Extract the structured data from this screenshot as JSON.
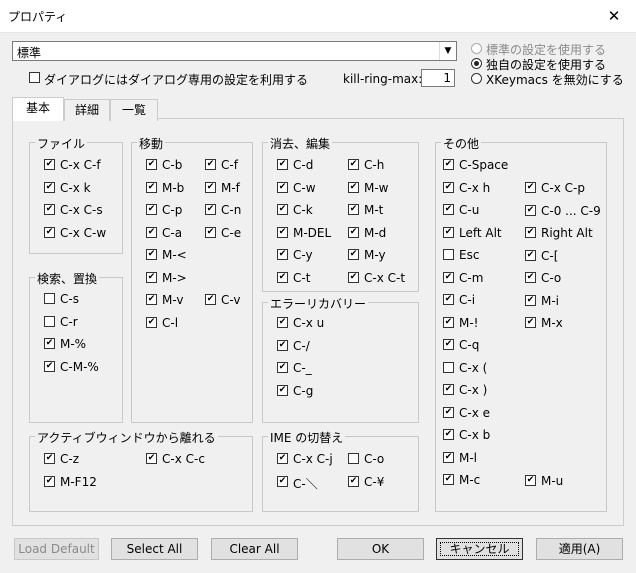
{
  "window": {
    "title": "プロパティ",
    "close_glyph": "✕"
  },
  "combo": {
    "value": "標準",
    "arrow": "▼"
  },
  "top_options": {
    "dialog_setting": {
      "label": "ダイアログにはダイアログ専用の設定を利用する",
      "checked": false
    },
    "kill_ring": {
      "label": "kill-ring-max:",
      "value": "1"
    },
    "radios": [
      {
        "label": "標準の設定を使用する",
        "selected": false,
        "disabled": true
      },
      {
        "label": "独自の設定を使用する",
        "selected": true,
        "disabled": false
      },
      {
        "label": "XKeymacs を無効にする",
        "selected": false,
        "disabled": false
      }
    ]
  },
  "tabs": [
    {
      "label": "基本"
    },
    {
      "label": "詳細"
    },
    {
      "label": "一覧"
    }
  ],
  "groups": {
    "file": {
      "title": "ファイル",
      "items": [
        {
          "label": "C-x C-f",
          "checked": true
        },
        {
          "label": "C-x k",
          "checked": true
        },
        {
          "label": "C-x C-s",
          "checked": true
        },
        {
          "label": "C-x C-w",
          "checked": true
        }
      ]
    },
    "search": {
      "title": "検索、置換",
      "items": [
        {
          "label": "C-s",
          "checked": false
        },
        {
          "label": "C-r",
          "checked": false
        },
        {
          "label": "M-%",
          "checked": true
        },
        {
          "label": "C-M-%",
          "checked": true
        }
      ]
    },
    "move": {
      "title": "移動",
      "col1": [
        {
          "label": "C-b",
          "checked": true
        },
        {
          "label": "M-b",
          "checked": true
        },
        {
          "label": "C-p",
          "checked": true
        },
        {
          "label": "C-a",
          "checked": true
        },
        {
          "label": "M-<",
          "checked": true
        },
        {
          "label": "M->",
          "checked": true
        },
        {
          "label": "M-v",
          "checked": true
        },
        {
          "label": "C-l",
          "checked": true
        }
      ],
      "col2": [
        {
          "label": "C-f",
          "checked": true
        },
        {
          "label": "M-f",
          "checked": true
        },
        {
          "label": "C-n",
          "checked": true
        },
        {
          "label": "C-e",
          "checked": true
        },
        {
          "label": "C-v",
          "checked": true
        }
      ]
    },
    "edit": {
      "title": "消去、編集",
      "col1": [
        {
          "label": "C-d",
          "checked": true
        },
        {
          "label": "C-w",
          "checked": true
        },
        {
          "label": "C-k",
          "checked": true
        },
        {
          "label": "M-DEL",
          "checked": true
        },
        {
          "label": "C-y",
          "checked": true
        },
        {
          "label": "C-t",
          "checked": true
        }
      ],
      "col2": [
        {
          "label": "C-h",
          "checked": true
        },
        {
          "label": "M-w",
          "checked": true
        },
        {
          "label": "M-t",
          "checked": true
        },
        {
          "label": "M-d",
          "checked": true
        },
        {
          "label": "M-y",
          "checked": true
        },
        {
          "label": "C-x C-t",
          "checked": true
        }
      ]
    },
    "recovery": {
      "title": "エラーリカバリー",
      "items": [
        {
          "label": "C-x u",
          "checked": true
        },
        {
          "label": "C-/",
          "checked": true
        },
        {
          "label": "C-_",
          "checked": true
        },
        {
          "label": "C-g",
          "checked": true
        }
      ]
    },
    "other": {
      "title": "その他",
      "col1": [
        {
          "label": "C-Space",
          "checked": true
        },
        {
          "label": "C-x h",
          "checked": true
        },
        {
          "label": "C-u",
          "checked": true
        },
        {
          "label": "Left Alt",
          "checked": true
        },
        {
          "label": "Esc",
          "checked": false
        },
        {
          "label": "C-m",
          "checked": true
        },
        {
          "label": "C-i",
          "checked": true
        },
        {
          "label": "M-!",
          "checked": true
        },
        {
          "label": "C-q",
          "checked": true
        },
        {
          "label": "C-x (",
          "checked": false
        },
        {
          "label": "C-x )",
          "checked": true
        },
        {
          "label": "C-x e",
          "checked": true
        },
        {
          "label": "C-x b",
          "checked": true
        },
        {
          "label": "M-l",
          "checked": true
        },
        {
          "label": "M-c",
          "checked": true
        }
      ],
      "col2": [
        {
          "label": "C-x C-p",
          "checked": true
        },
        {
          "label": "C-0 ... C-9",
          "checked": true
        },
        {
          "label": "Right Alt",
          "checked": true
        },
        {
          "label": "C-[",
          "checked": true
        },
        {
          "label": "C-o",
          "checked": true
        },
        {
          "label": "M-i",
          "checked": true
        },
        {
          "label": "M-x",
          "checked": true
        },
        {
          "label": "M-u",
          "checked": true
        }
      ]
    },
    "active": {
      "title": "アクティブウィンドウから離れる",
      "items": [
        {
          "label": "C-z",
          "checked": true
        },
        {
          "label": "C-x C-c",
          "checked": true
        },
        {
          "label": "M-F12",
          "checked": true
        }
      ]
    },
    "ime": {
      "title": "IME の切替え",
      "items": [
        {
          "label": "C-x C-j",
          "checked": true
        },
        {
          "label": "C-o",
          "checked": false
        },
        {
          "label": "C-＼",
          "checked": true
        },
        {
          "label": "C-¥",
          "checked": true
        }
      ]
    }
  },
  "buttons": {
    "load_default": "Load Default",
    "select_all": "Select All",
    "clear_all": "Clear All",
    "ok": "OK",
    "cancel": "キャンセル",
    "apply": "適用(A)"
  },
  "check_glyph": "✔"
}
